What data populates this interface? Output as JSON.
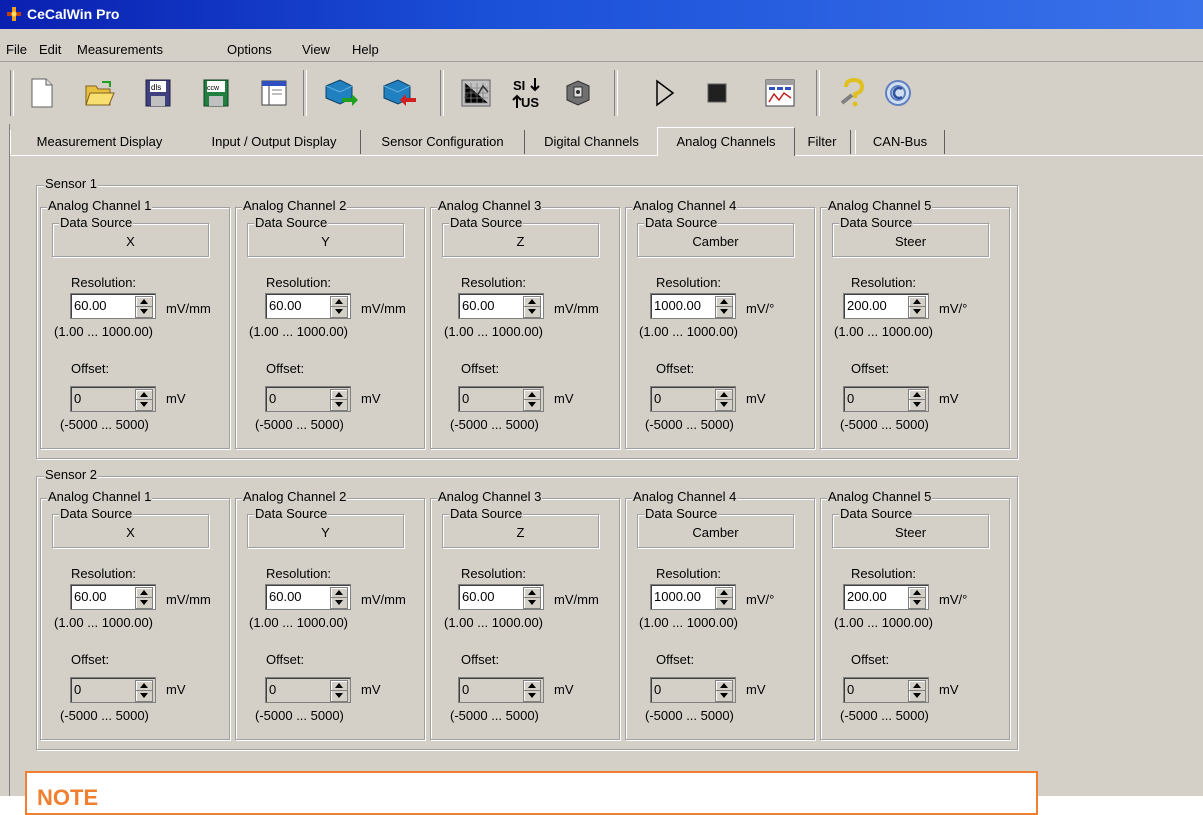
{
  "window": {
    "title": "CeCalWin Pro"
  },
  "menu": [
    "File",
    "Edit",
    "Measurements",
    "Options",
    "View",
    "Help"
  ],
  "toolbar": [
    "new-icon",
    "open-icon",
    "save-dls-icon",
    "save-ccw-icon",
    "window-icon",
    "connect-icon",
    "disconnect-icon",
    "graph-icon",
    "si-us-units-icon",
    "sensor-icon",
    "play-icon",
    "stop-icon",
    "chart-window-icon",
    "help-icon",
    "about-icon"
  ],
  "tabs": [
    "Measurement Display",
    "Input / Output Display",
    "Sensor Configuration",
    "Digital Channels",
    "Analog Channels",
    "Filter",
    "CAN-Bus"
  ],
  "active_tab": "Analog Channels",
  "sensors": [
    {
      "label": "Sensor 1",
      "channels": [
        {
          "label": "Analog Channel 1",
          "data_source_label": "Data Source",
          "data_source": "X",
          "resolution_label": "Resolution:",
          "resolution": "60.00",
          "resolution_unit": "mV/mm",
          "resolution_range": "(1.00 ... 1000.00)",
          "offset_label": "Offset:",
          "offset": "0",
          "offset_unit": "mV",
          "offset_range": "(-5000 ... 5000)"
        },
        {
          "label": "Analog Channel 2",
          "data_source_label": "Data Source",
          "data_source": "Y",
          "resolution_label": "Resolution:",
          "resolution": "60.00",
          "resolution_unit": "mV/mm",
          "resolution_range": "(1.00 ... 1000.00)",
          "offset_label": "Offset:",
          "offset": "0",
          "offset_unit": "mV",
          "offset_range": "(-5000 ... 5000)"
        },
        {
          "label": "Analog Channel 3",
          "data_source_label": "Data Source",
          "data_source": "Z",
          "resolution_label": "Resolution:",
          "resolution": "60.00",
          "resolution_unit": "mV/mm",
          "resolution_range": "(1.00 ... 1000.00)",
          "offset_label": "Offset:",
          "offset": "0",
          "offset_unit": "mV",
          "offset_range": "(-5000 ... 5000)"
        },
        {
          "label": "Analog Channel 4",
          "data_source_label": "Data Source",
          "data_source": "Camber",
          "resolution_label": "Resolution:",
          "resolution": "1000.00",
          "resolution_unit": "mV/°",
          "resolution_range": "(1.00 ... 1000.00)",
          "offset_label": "Offset:",
          "offset": "0",
          "offset_unit": "mV",
          "offset_range": "(-5000 ... 5000)"
        },
        {
          "label": "Analog Channel 5",
          "data_source_label": "Data Source",
          "data_source": "Steer",
          "resolution_label": "Resolution:",
          "resolution": "200.00",
          "resolution_unit": "mV/°",
          "resolution_range": "(1.00 ... 1000.00)",
          "offset_label": "Offset:",
          "offset": "0",
          "offset_unit": "mV",
          "offset_range": "(-5000 ... 5000)"
        }
      ]
    },
    {
      "label": "Sensor 2",
      "channels": [
        {
          "label": "Analog Channel 1",
          "data_source_label": "Data Source",
          "data_source": "X",
          "resolution_label": "Resolution:",
          "resolution": "60.00",
          "resolution_unit": "mV/mm",
          "resolution_range": "(1.00 ... 1000.00)",
          "offset_label": "Offset:",
          "offset": "0",
          "offset_unit": "mV",
          "offset_range": "(-5000 ... 5000)"
        },
        {
          "label": "Analog Channel 2",
          "data_source_label": "Data Source",
          "data_source": "Y",
          "resolution_label": "Resolution:",
          "resolution": "60.00",
          "resolution_unit": "mV/mm",
          "resolution_range": "(1.00 ... 1000.00)",
          "offset_label": "Offset:",
          "offset": "0",
          "offset_unit": "mV",
          "offset_range": "(-5000 ... 5000)"
        },
        {
          "label": "Analog Channel 3",
          "data_source_label": "Data Source",
          "data_source": "Z",
          "resolution_label": "Resolution:",
          "resolution": "60.00",
          "resolution_unit": "mV/mm",
          "resolution_range": "(1.00 ... 1000.00)",
          "offset_label": "Offset:",
          "offset": "0",
          "offset_unit": "mV",
          "offset_range": "(-5000 ... 5000)"
        },
        {
          "label": "Analog Channel 4",
          "data_source_label": "Data Source",
          "data_source": "Camber",
          "resolution_label": "Resolution:",
          "resolution": "1000.00",
          "resolution_unit": "mV/°",
          "resolution_range": "(1.00 ... 1000.00)",
          "offset_label": "Offset:",
          "offset": "0",
          "offset_unit": "mV",
          "offset_range": "(-5000 ... 5000)"
        },
        {
          "label": "Analog Channel 5",
          "data_source_label": "Data Source",
          "data_source": "Steer",
          "resolution_label": "Resolution:",
          "resolution": "200.00",
          "resolution_unit": "mV/°",
          "resolution_range": "(1.00 ... 1000.00)",
          "offset_label": "Offset:",
          "offset": "0",
          "offset_unit": "mV",
          "offset_range": "(-5000 ... 5000)"
        }
      ]
    }
  ],
  "note": {
    "title": "NOTE"
  },
  "colors": {
    "face": "#d4d0c8",
    "title_start": "#0a1fb0",
    "title_end": "#3a72ea",
    "note_border": "#f08030"
  }
}
